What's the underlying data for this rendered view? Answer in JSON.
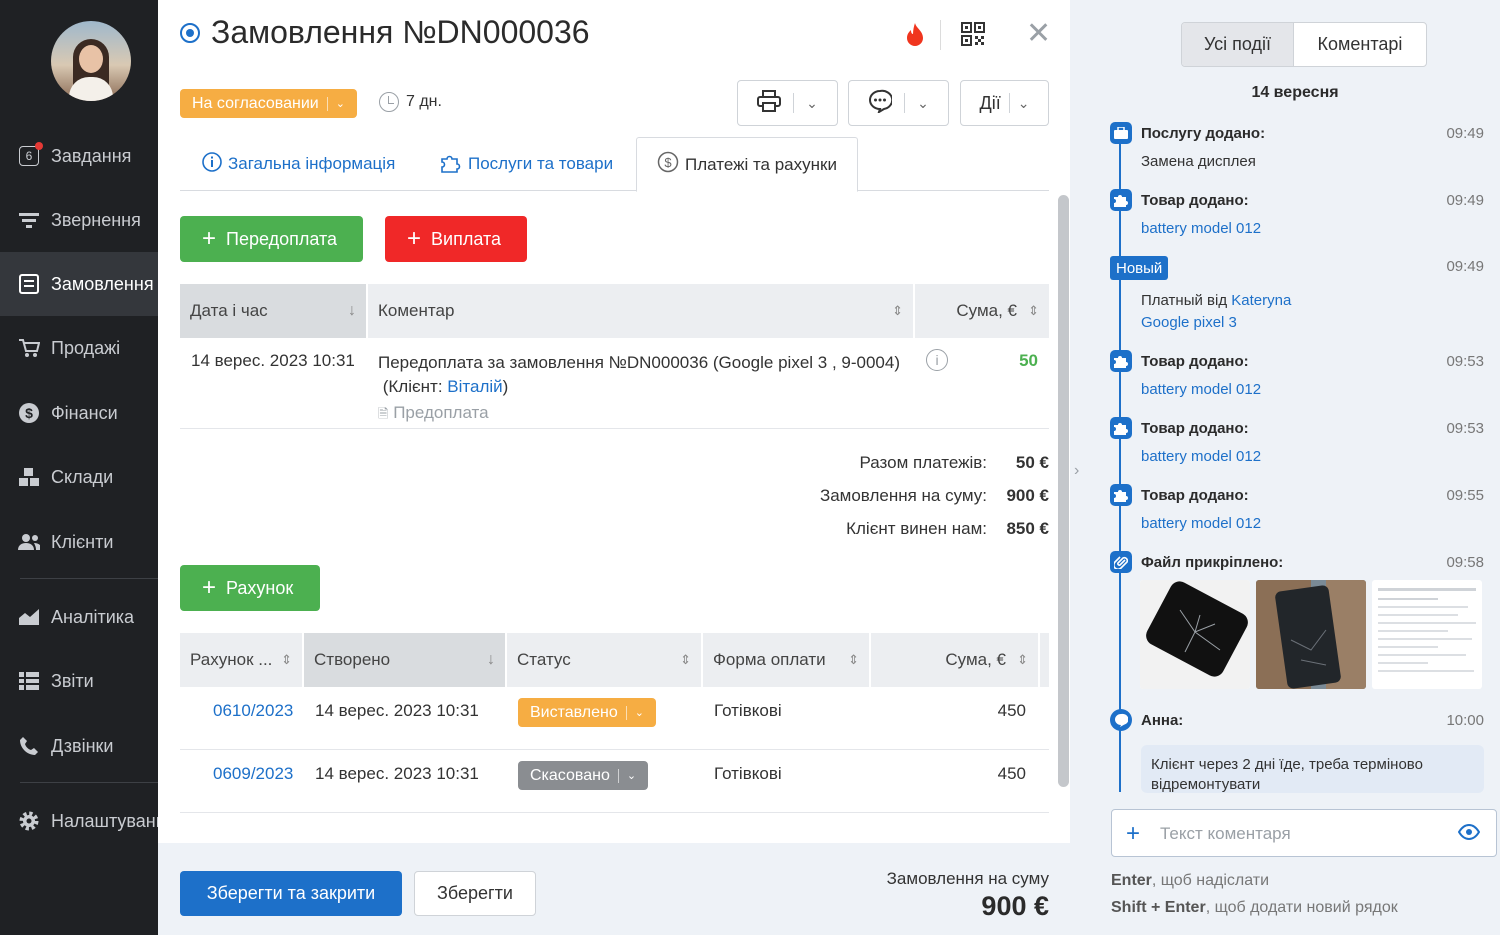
{
  "sidebar": {
    "items": [
      {
        "label": "Завдання",
        "badge": "6",
        "icon": "tasks-icon"
      },
      {
        "label": "Звернення",
        "icon": "filter-icon"
      },
      {
        "label": "Замовлення",
        "icon": "orders-icon",
        "active": true
      },
      {
        "label": "Продажі",
        "icon": "cart-icon"
      },
      {
        "label": "Фінанси",
        "icon": "dollar-icon"
      },
      {
        "label": "Склади",
        "icon": "boxes-icon"
      },
      {
        "label": "Клієнти",
        "icon": "users-icon"
      },
      {
        "label": "Аналітика",
        "icon": "chart-icon"
      },
      {
        "label": "Звіти",
        "icon": "list-icon"
      },
      {
        "label": "Дзвінки",
        "icon": "phone-icon"
      },
      {
        "label": "Налаштування",
        "icon": "gear-icon"
      }
    ]
  },
  "order": {
    "title": "Замовлення №DN000036",
    "status": "На согласовании",
    "days": "7 дн.",
    "actions_label": "Дії"
  },
  "tabs": [
    {
      "label": "Загальна інформація"
    },
    {
      "label": "Послуги та товари"
    },
    {
      "label": "Платежі та рахунки"
    }
  ],
  "payments": {
    "prepay_label": "Передоплата",
    "payout_label": "Виплата",
    "columns": [
      "Дата і час",
      "Коментар",
      "Сума, €"
    ],
    "rows": [
      {
        "date": "14 верес. 2023 10:31",
        "comment": "Передоплата за замовлення №DN000036 (Google pixel 3 , 9-0004)",
        "client_prefix": "(Клієнт: ",
        "client": "Віталій",
        "client_suffix": ")",
        "doc": "Предоплата",
        "amount": "50"
      }
    ],
    "totals": [
      {
        "label": "Разом платежів:",
        "value": "50 €"
      },
      {
        "label": "Замовлення на суму:",
        "value": "900 €"
      },
      {
        "label": "Клієнт винен нам:",
        "value": "850 €"
      }
    ]
  },
  "invoices": {
    "add_label": "Рахунок",
    "columns": [
      "Рахунок ...",
      "Створено",
      "Статус",
      "Форма оплати",
      "Сума, €"
    ],
    "rows": [
      {
        "number": "0610/2023",
        "created": "14 верес. 2023 10:31",
        "status": "Виставлено",
        "status_color": "#f6ad43",
        "payment": "Готівкові",
        "sum": "450"
      },
      {
        "number": "0609/2023",
        "created": "14 верес. 2023 10:31",
        "status": "Скасовано",
        "status_color": "#8a8d91",
        "payment": "Готівкові",
        "sum": "450"
      }
    ]
  },
  "footer": {
    "save_close": "Зберегти та закрити",
    "save": "Зберегти",
    "total_label": "Замовлення на суму",
    "total": "900 €"
  },
  "history": {
    "tab_all": "Усі події",
    "tab_comments": "Коментарі",
    "date": "14 вересня",
    "events": [
      {
        "title": "Послугу додано:",
        "time": "09:49",
        "text": "Замена дисплея"
      },
      {
        "title": "Товар додано:",
        "time": "09:49",
        "link": "battery model 012"
      },
      {
        "badge": "Новый",
        "time": "09:49",
        "text": "Платный від ",
        "link": "Kateryna",
        "link2": "Google pixel 3"
      },
      {
        "title": "Товар додано:",
        "time": "09:53",
        "link": "battery model 012"
      },
      {
        "title": "Товар додано:",
        "time": "09:53",
        "link": "battery model 012"
      },
      {
        "title": "Товар додано:",
        "time": "09:55",
        "link": "battery model 012"
      },
      {
        "title": "Файл прикріплено:",
        "time": "09:58"
      },
      {
        "title": "Анна:",
        "time": "10:00",
        "text": "Клієнт через 2 дні їде, треба терміново відремонтувати"
      }
    ],
    "comment_placeholder": "Текст коментаря",
    "hint1_key": "Enter",
    "hint1_text": ", щоб надіслати",
    "hint2_key": "Shift + Enter",
    "hint2_text": ", щоб додати новий рядок"
  },
  "colors": {
    "primary": "#1d70c9",
    "success": "#4cb050",
    "danger": "#f02828",
    "warning": "#f6ad43"
  }
}
